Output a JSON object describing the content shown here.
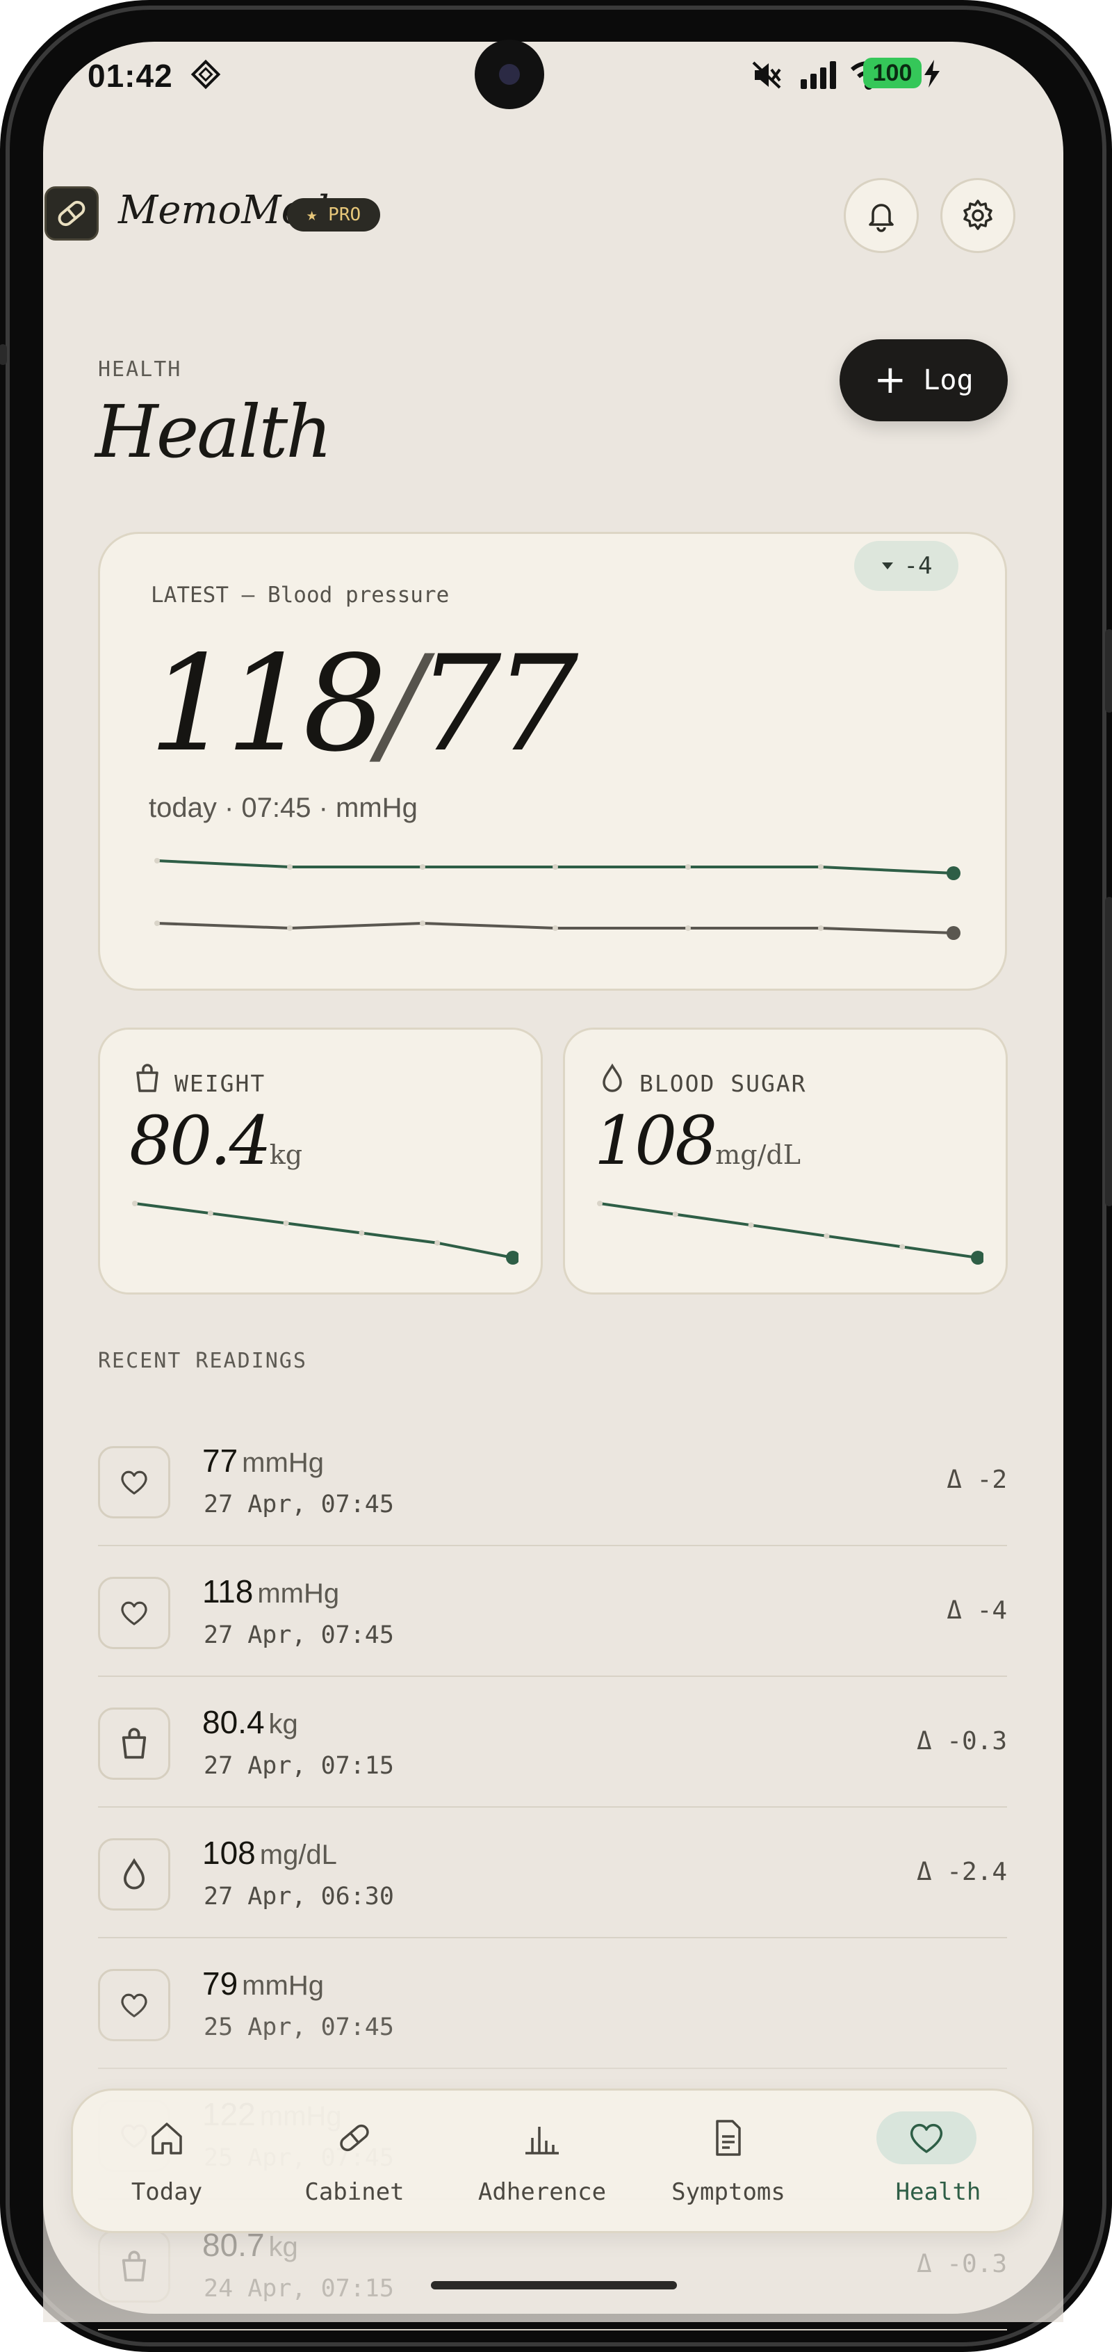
{
  "status_bar": {
    "time": "01:42",
    "battery": "100",
    "icons": [
      "diamond-icon",
      "mute-icon",
      "signal-icon",
      "wifi-icon",
      "bolt-icon"
    ]
  },
  "header": {
    "app_name": "MemoMed",
    "pro_label": "PRO",
    "page_eyebrow": "HEALTH",
    "page_title": "Health",
    "log_label": "Log"
  },
  "latest_card": {
    "label": "LATEST — Blood pressure",
    "delta": "-4",
    "systolic": "118",
    "diastolic": "77",
    "meta": "today · 07:45 · mmHg",
    "systolic_trend": [
      122,
      120,
      120,
      120,
      120,
      120,
      118
    ],
    "diastolic_trend": [
      79,
      78,
      79,
      78,
      78,
      78,
      77
    ]
  },
  "weight_card": {
    "label": "WEIGHT",
    "value": "80.4",
    "unit": "kg",
    "trend": [
      81.5,
      81.3,
      81.1,
      80.9,
      80.7,
      80.4
    ]
  },
  "sugar_card": {
    "label": "BLOOD SUGAR",
    "value": "108",
    "unit": "mg/dL",
    "trend": [
      116,
      114.4,
      112.8,
      111.2,
      109.6,
      108
    ]
  },
  "recent": {
    "heading": "RECENT READINGS",
    "items": [
      {
        "value": "77",
        "unit": "mmHg",
        "time": "27 Apr, 07:45",
        "delta": "Δ -2",
        "icon": "heart-icon"
      },
      {
        "value": "118",
        "unit": "mmHg",
        "time": "27 Apr, 07:45",
        "delta": "Δ -4",
        "icon": "heart-icon"
      },
      {
        "value": "80.4",
        "unit": "kg",
        "time": "27 Apr, 07:15",
        "delta": "Δ -0.3",
        "icon": "scale-bag-icon"
      },
      {
        "value": "108",
        "unit": "mg/dL",
        "time": "27 Apr, 06:30",
        "delta": "Δ -2.4",
        "icon": "drop-icon"
      },
      {
        "value": "79",
        "unit": "mmHg",
        "time": "25 Apr, 07:45",
        "delta": "",
        "icon": "heart-icon"
      },
      {
        "value": "122",
        "unit": "mmHg",
        "time": "25 Apr, 07:45",
        "delta": "",
        "icon": "heart-icon"
      },
      {
        "value": "80.7",
        "unit": "kg",
        "time": "24 Apr, 07:15",
        "delta": "Δ -0.3",
        "icon": "scale-bag-icon"
      }
    ]
  },
  "tabs": [
    {
      "label": "Today",
      "icon": "home-icon"
    },
    {
      "label": "Cabinet",
      "icon": "pill-icon"
    },
    {
      "label": "Adherence",
      "icon": "bar-chart-icon"
    },
    {
      "label": "Symptoms",
      "icon": "document-icon"
    },
    {
      "label": "Health",
      "icon": "heart-icon",
      "active": true
    }
  ],
  "colors": {
    "background": "#ebe6df",
    "card": "#f5f1e8",
    "accent_green": "#2e5e46",
    "dark": "#1c1b19",
    "pro_gold": "#e7c77a"
  }
}
